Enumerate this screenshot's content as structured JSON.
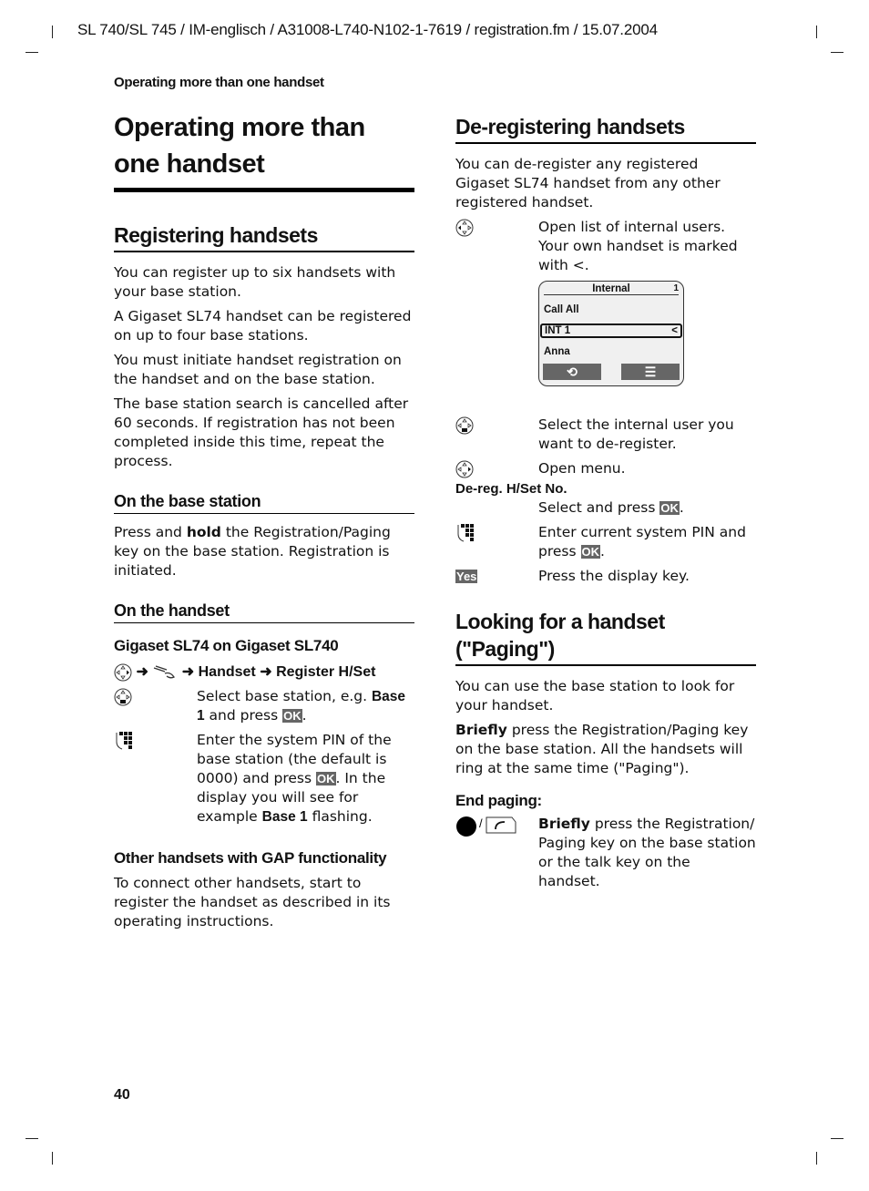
{
  "page_header": "SL 740/SL 745 / IM-englisch / A31008-L740-N102-1-7619 / registration.fm / 15.07.2004",
  "running_title": "Operating more than one handset",
  "page_number": "40",
  "left": {
    "title": "Operating more than one handset",
    "registering": {
      "heading": "Registering handsets",
      "paragraphs": [
        "You can register up to six handsets with your base station.",
        "A Gigaset SL74 handset can be registered on up to four base stations.",
        "You must initiate handset registration on the handset and on the base station.",
        "The base station search is cancelled after 60 seconds. If registration has not been completed inside this time, repeat the process."
      ]
    },
    "base_station": {
      "heading": "On the base station",
      "text_pre": "Press and ",
      "text_bold": "hold",
      "text_post": " the Registration/Paging key on the base station. Registration is initiated."
    },
    "handset": {
      "heading": "On the handset",
      "subheading": "Gigaset SL74 on Gigaset SL740",
      "path_arrow": "➜",
      "path_items": [
        "Handset",
        "Register H/Set"
      ],
      "step1_pre": "Select base station, e.g. ",
      "step1_bold": "Base 1",
      "step1_post": " and press ",
      "ok": "OK",
      "step2_pre": "Enter the system PIN of the base station (the default is 0000) and press ",
      "step2_mid": ". In the display you will see for example ",
      "step2_bold": "Base 1",
      "step2_post": " flashing."
    },
    "gap": {
      "heading": "Other handsets with GAP functionality",
      "text": "To connect other handsets, start to register the handset as described in its operating instructions."
    }
  },
  "right": {
    "deregister": {
      "heading": "De-registering handsets",
      "intro": "You can de-register any registered Gigaset SL74 handset from any other registered handset.",
      "step1": "Open list of internal users. Your own handset is marked with <.",
      "screen": {
        "title": "Internal",
        "corner": "1",
        "items": [
          "Call All",
          "INT 1",
          "Anna"
        ],
        "selected_marker": "<",
        "softkey_left": "back-icon",
        "softkey_right": "menu-icon"
      },
      "step2": "Select the internal user you want to de-register.",
      "step3": "Open menu.",
      "menu_item": "De-reg. H/Set No.",
      "step4": "Select and press ",
      "step5": "Enter current system PIN and press ",
      "yes": "Yes",
      "step6": "Press the display key.",
      "ok": "OK"
    },
    "paging": {
      "heading": "Looking for a handset (\"Paging\")",
      "intro": "You can use the base station to look for your handset.",
      "para_bold": "Briefly",
      "para": " press the Registration/Paging key on the base station. All the handsets will ring at the same time (\"Paging\").",
      "end_heading": "End paging:",
      "end_bold": "Briefly",
      "end_text": " press the Registration/ Paging key on the base station or the talk key on the handset."
    }
  }
}
